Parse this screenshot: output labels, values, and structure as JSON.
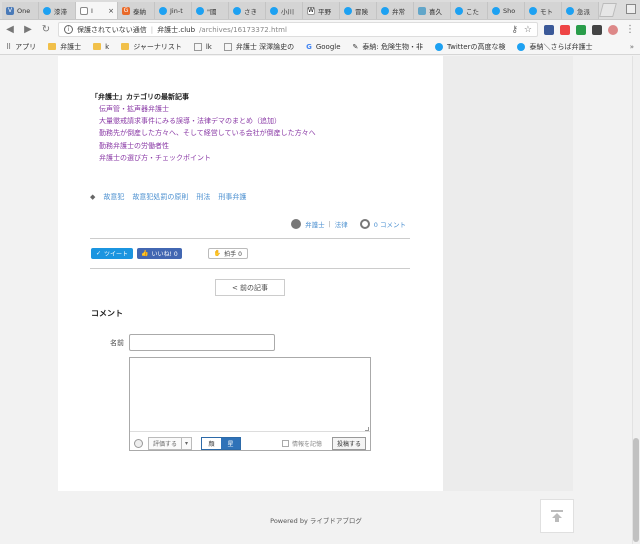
{
  "browser": {
    "tabs": [
      {
        "label": "One",
        "icon": "v-icon",
        "active": false
      },
      {
        "label": "漆滞",
        "icon": "twitter-icon",
        "active": false
      },
      {
        "label": "I",
        "icon": "document-icon",
        "active": true
      },
      {
        "label": "泰納",
        "icon": "google-icon",
        "active": false
      },
      {
        "label": "Jin-t",
        "icon": "twitter-icon",
        "active": false
      },
      {
        "label": "\"國",
        "icon": "twitter-icon",
        "active": false
      },
      {
        "label": "さき",
        "icon": "twitter-icon",
        "active": false
      },
      {
        "label": "小川",
        "icon": "twitter-icon",
        "active": false
      },
      {
        "label": "平野",
        "icon": "wikipedia-icon",
        "active": false
      },
      {
        "label": "冒険",
        "icon": "twitter-icon",
        "active": false
      },
      {
        "label": "弁常",
        "icon": "twitter-icon",
        "active": false
      },
      {
        "label": "喜久",
        "icon": "image-icon",
        "active": false
      },
      {
        "label": "こた",
        "icon": "twitter-icon",
        "active": false
      },
      {
        "label": "Sho",
        "icon": "twitter-icon",
        "active": false
      },
      {
        "label": "モト",
        "icon": "twitter-icon",
        "active": false
      },
      {
        "label": "急派",
        "icon": "twitter-icon",
        "active": false
      }
    ],
    "address": {
      "security": "保護されていない通信",
      "domain": "弁護士.club",
      "path": "/archives/16173372.html"
    },
    "bookmarks": [
      {
        "label": "アプリ",
        "icon": "apps-icon"
      },
      {
        "label": "弁護士",
        "icon": "folder-icon"
      },
      {
        "label": "k",
        "icon": "folder-icon"
      },
      {
        "label": "ジャーナリスト",
        "icon": "folder-icon"
      },
      {
        "label": "lk",
        "icon": "document-icon"
      },
      {
        "label": "弁護士 深澤論史の",
        "icon": "document-icon"
      },
      {
        "label": "Google",
        "icon": "google-icon"
      },
      {
        "label": "泰納: 危険生物・非",
        "icon": "blog-icon"
      },
      {
        "label": "Twitterの高度な検",
        "icon": "twitter-icon"
      },
      {
        "label": "泰納＼さらば弁護士",
        "icon": "twitter-icon"
      }
    ],
    "bookmarks_more": "»"
  },
  "article": {
    "related_title": "「弁護士」カテゴリの最新記事",
    "related": [
      "伝声管・拡声器弁護士",
      "大量懲戒請求事件にみる誤導・法律デマのまとめ（追加）",
      "勤務先が倒産した方々へ、そして経営している会社が倒産した方々へ",
      "勤務弁護士の労働者性",
      "弁護士の選び方・チェックポイント"
    ],
    "tags": [
      "故意犯",
      "故意犯処罰の原則",
      "刑法",
      "刑事弁護"
    ],
    "meta": {
      "category_a": "弁護士",
      "separator": "|",
      "category_b": "法律",
      "comments": "0 コメント"
    },
    "share": {
      "tweet": "ツイート",
      "like": "いいね! 0",
      "clap": "拍手 0"
    },
    "prev_label": "< 前の記事"
  },
  "comment_form": {
    "heading": "コメント",
    "name_label": "名前",
    "name_value": "",
    "comment_value": "",
    "rating_label": "評価する",
    "rating_caret": "▾",
    "toggle_off": "顔",
    "toggle_on": "星",
    "remember_label": "情報を記憶",
    "submit_label": "投稿する"
  },
  "footer": {
    "powered": "Powered by ライブドアブログ"
  },
  "colors": {
    "link_purple": "#8a3aa6",
    "link_blue": "#4a8fd0",
    "twitter_blue": "#1b95e0",
    "facebook_blue": "#4267b2",
    "toggle_active": "#2f72b8"
  }
}
